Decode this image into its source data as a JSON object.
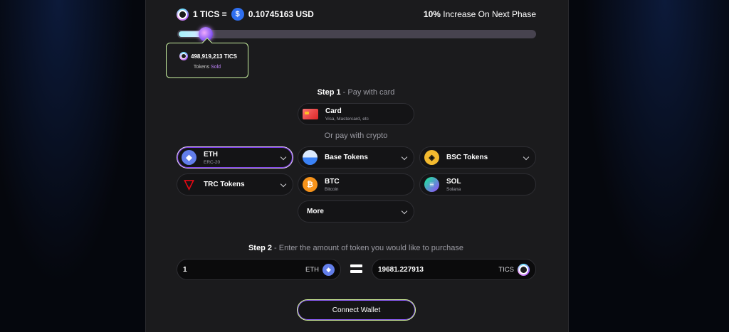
{
  "rate": {
    "lhs": "1 TICS =",
    "rhs": "0.10745163 USD",
    "usd_symbol": "$"
  },
  "phase": {
    "percent": "10%",
    "text": " Increase On Next Phase"
  },
  "progress": {
    "fraction": 0.08
  },
  "sold": {
    "amount": "498,919,213 TICS",
    "label_prefix": "Tokens ",
    "label_highlight": "Sold"
  },
  "step1": {
    "bold": "Step 1",
    "rest": " - Pay with card"
  },
  "card_option": {
    "title": "Card",
    "subtitle": "Visa, Mastercard, etc"
  },
  "crypto_divider": "Or pay with crypto",
  "crypto_options": {
    "eth": {
      "title": "ETH",
      "subtitle": "ERC-20",
      "glyph": "◆",
      "color": "#627eea"
    },
    "base": {
      "title": "Base Tokens",
      "color": "#3b82f6"
    },
    "bsc": {
      "title": "BSC Tokens",
      "glyph": "◈",
      "color": "#f3ba2f"
    },
    "trc": {
      "title": "TRC Tokens",
      "glyph": "▽",
      "color": "#e50914"
    },
    "btc": {
      "title": "BTC",
      "subtitle": "Bitcoin",
      "glyph": "₿",
      "color": "#f7931a"
    },
    "sol": {
      "title": "SOL",
      "subtitle": "Solana",
      "glyph": "≡",
      "color": "#9945ff"
    },
    "more": {
      "title": "More"
    }
  },
  "step2": {
    "bold": "Step 2",
    "rest": " - Enter the amount of token you would like to purchase"
  },
  "pay_input": {
    "value": "1",
    "unit": "ETH"
  },
  "receive_input": {
    "value": "19681.227913",
    "unit": "TICS"
  },
  "connect_button": "Connect Wallet"
}
